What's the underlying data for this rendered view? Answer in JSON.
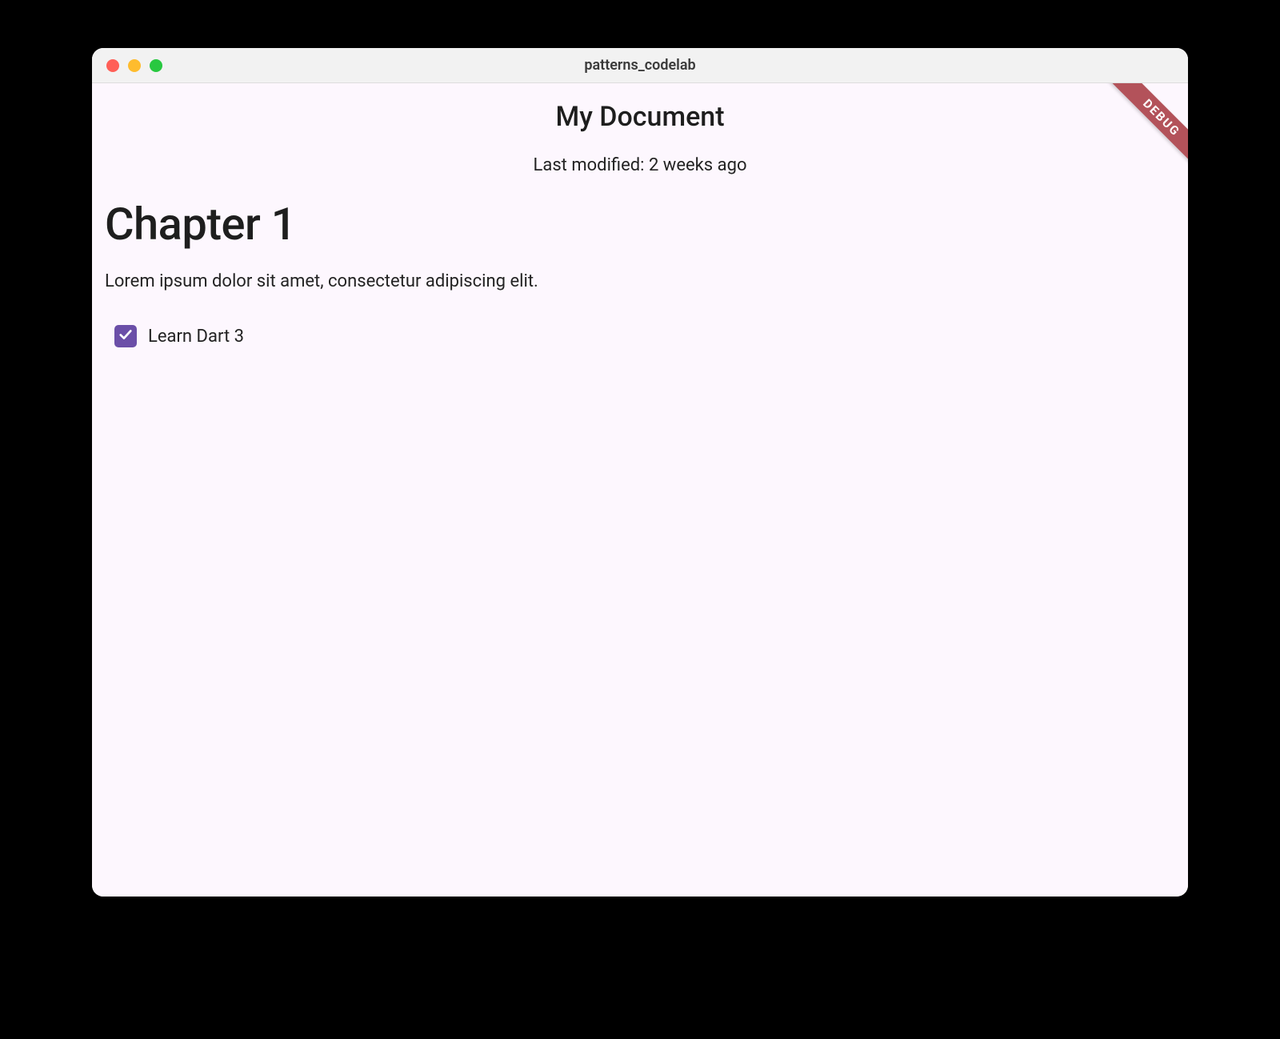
{
  "window": {
    "title": "patterns_codelab"
  },
  "debug_banner": "DEBUG",
  "header": {
    "title": "My Document",
    "last_modified": "Last modified: 2 weeks ago"
  },
  "document": {
    "heading": "Chapter 1",
    "paragraph": "Lorem ipsum dolor sit amet, consectetur adipiscing elit.",
    "checkbox": {
      "label": "Learn Dart 3",
      "checked": true
    }
  },
  "colors": {
    "accent": "#6b4fa8",
    "background": "#fdf7fe",
    "debug_banner": "#b3525a"
  }
}
